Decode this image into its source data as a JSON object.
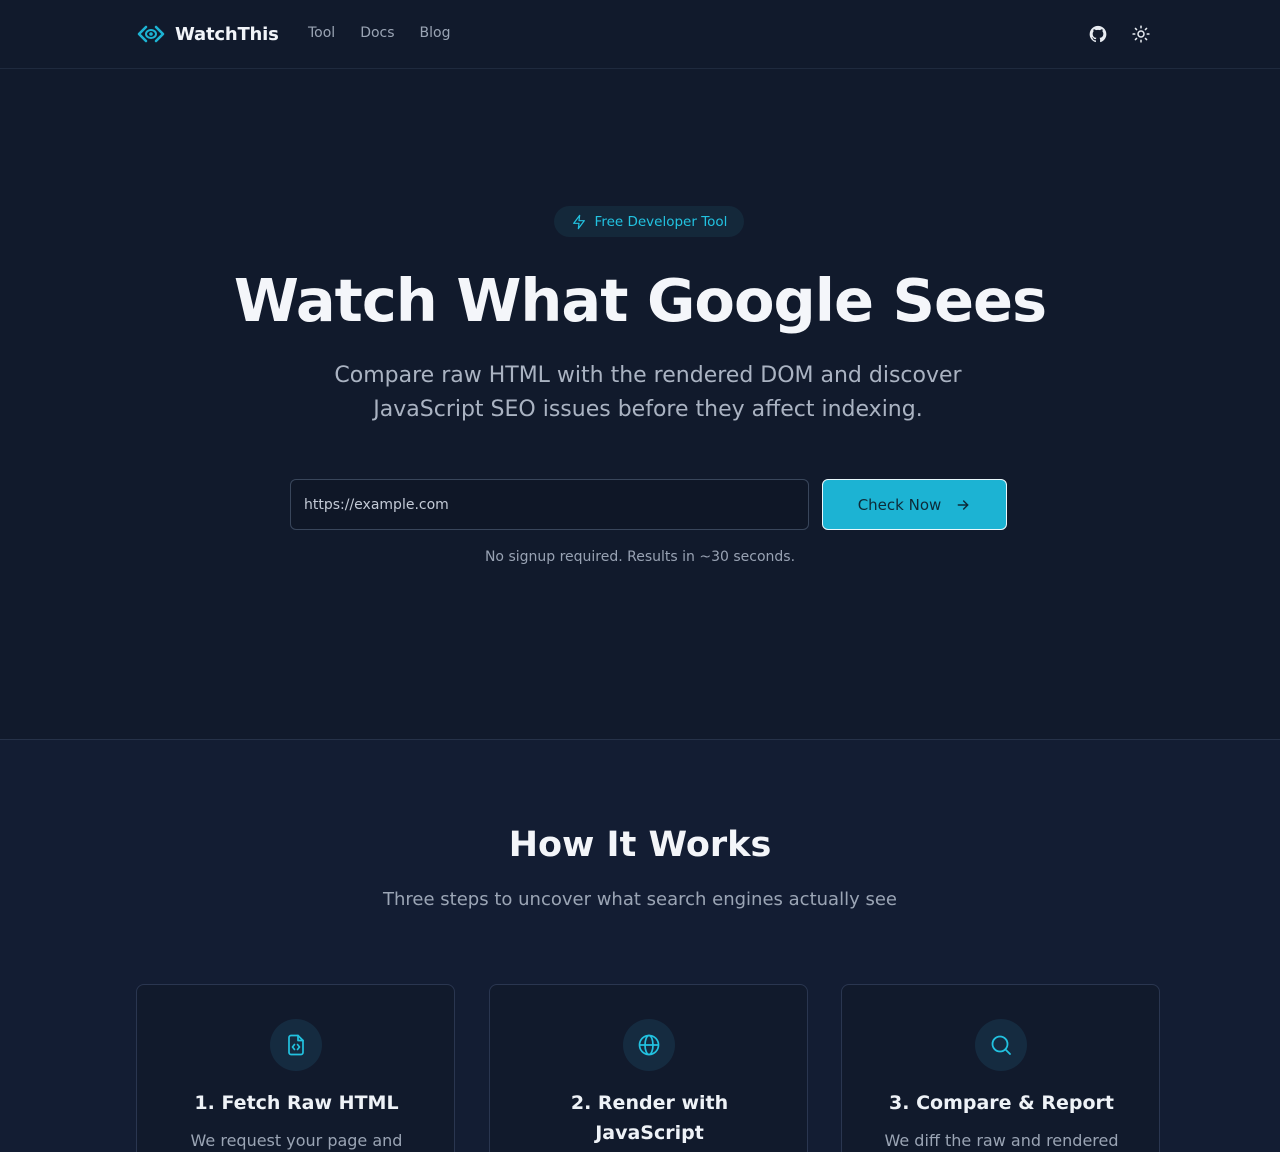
{
  "header": {
    "brand": "WatchThis",
    "nav": [
      "Tool",
      "Docs",
      "Blog"
    ],
    "icons": [
      "github-icon",
      "sun-icon"
    ]
  },
  "hero": {
    "badge": "Free Developer Tool",
    "title": "Watch What Google Sees",
    "subtitle_line1": "Compare raw HTML with the rendered DOM and discover",
    "subtitle_line2": "JavaScript SEO issues before they affect indexing.",
    "input_placeholder": "https://example.com",
    "button_label": "Check Now",
    "note": "No signup required. Results in ~30 seconds."
  },
  "how": {
    "title": "How It Works",
    "subtitle": "Three steps to uncover what search engines actually see",
    "cards": [
      {
        "icon": "file-code-icon",
        "title": "1. Fetch Raw HTML",
        "title2": "",
        "desc": "We request your page and"
      },
      {
        "icon": "globe-icon",
        "title": "2. Render with",
        "title2": "JavaScript",
        "desc": ""
      },
      {
        "icon": "search-icon",
        "title": "3. Compare & Report",
        "title2": "",
        "desc": "We diff the raw and rendered"
      }
    ]
  },
  "colors": {
    "background": "#111a2c",
    "accent": "#1cb3d3",
    "badge_text": "#22c2e0"
  }
}
